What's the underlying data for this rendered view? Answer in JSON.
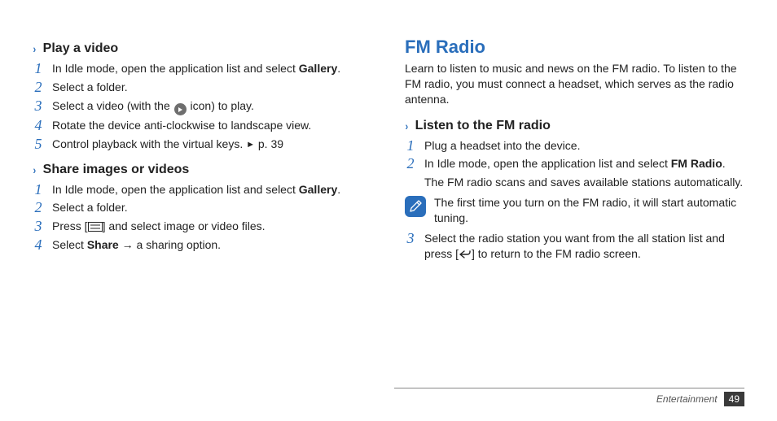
{
  "left": {
    "sections": [
      {
        "title": "Play a video",
        "steps": [
          {
            "n": "1",
            "pre": "In Idle mode, open the application list and select ",
            "bold": "Gallery",
            "post": "."
          },
          {
            "n": "2",
            "text": "Select a folder."
          },
          {
            "n": "3",
            "pre": "Select a video (with the ",
            "iconPlay": true,
            "post": " icon) to play."
          },
          {
            "n": "4",
            "text": "Rotate the device anti-clockwise to landscape view."
          },
          {
            "n": "5",
            "pre": "Control playback with the virtual keys. ",
            "tri": true,
            "post": " p. 39"
          }
        ]
      },
      {
        "title": "Share images or videos",
        "steps": [
          {
            "n": "1",
            "pre": "In Idle mode, open the application list and select ",
            "bold": "Gallery",
            "post": "."
          },
          {
            "n": "2",
            "text": "Select a folder."
          },
          {
            "n": "3",
            "pre": "Press [",
            "menuIcon": true,
            "post": "] and select image or video files."
          },
          {
            "n": "4",
            "pre": "Select ",
            "bold": "Share",
            "post": " → a sharing option."
          }
        ]
      }
    ]
  },
  "right": {
    "heading": "FM Radio",
    "intro": "Learn to listen to music and news on the FM radio. To listen to the FM radio, you must connect a headset, which serves as the radio antenna.",
    "section": {
      "title": "Listen to the FM radio",
      "steps": [
        {
          "n": "1",
          "text": "Plug a headset into the device."
        },
        {
          "n": "2",
          "pre": "In Idle mode, open the application list and select ",
          "bold": "FM Radio",
          "post": ".",
          "extra": "The FM radio scans and saves available stations automatically."
        },
        {
          "note": "The first time you turn on the FM radio, it will start automatic tuning."
        },
        {
          "n": "3",
          "pre": "Select the radio station you want from the all station list and press [",
          "backIcon": true,
          "post": "] to return to the FM radio screen."
        }
      ]
    }
  },
  "footer": {
    "category": "Entertainment",
    "page": "49"
  }
}
